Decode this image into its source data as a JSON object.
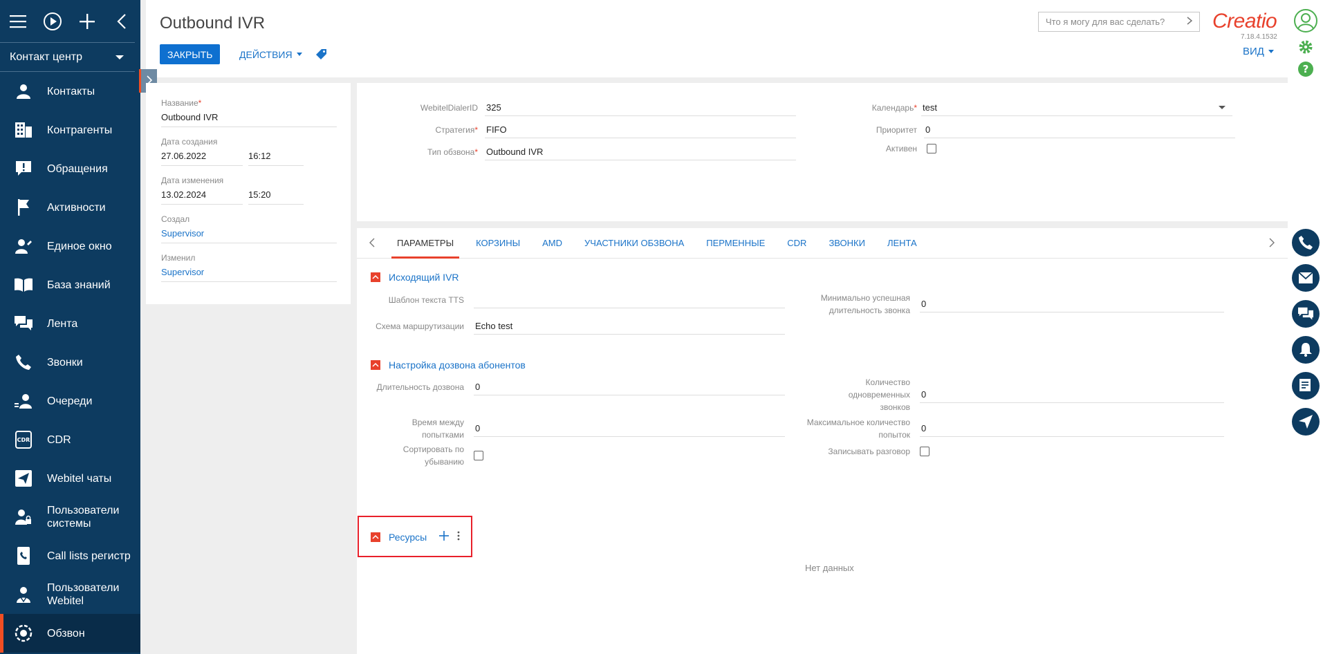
{
  "sidebar": {
    "section_label": "Контакт центр",
    "items": [
      {
        "label": "Контакты",
        "icon": "person-icon"
      },
      {
        "label": "Контрагенты",
        "icon": "building-icon"
      },
      {
        "label": "Обращения",
        "icon": "exclamation-icon"
      },
      {
        "label": "Активности",
        "icon": "flag-icon"
      },
      {
        "label": "Единое окно",
        "icon": "person-edit-icon"
      },
      {
        "label": "База знаний",
        "icon": "book-icon"
      },
      {
        "label": "Лента",
        "icon": "chat-icon"
      },
      {
        "label": "Звонки",
        "icon": "phone-icon"
      },
      {
        "label": "Очереди",
        "icon": "queue-icon"
      },
      {
        "label": "CDR",
        "icon": "cdr-icon"
      },
      {
        "label": "Webitel чаты",
        "icon": "send-icon"
      },
      {
        "label": "Пользователи системы",
        "icon": "user-lock-icon"
      },
      {
        "label": "Call lists регистр",
        "icon": "phone-book-icon"
      },
      {
        "label": "Пользователи Webitel",
        "icon": "users-icon"
      },
      {
        "label": "Обзвон",
        "icon": "dialer-icon"
      }
    ]
  },
  "header": {
    "title": "Outbound IVR",
    "close_label": "ЗАКРЫТЬ",
    "actions_label": "ДЕЙСТВИЯ",
    "search_placeholder": "Что я могу для вас сделать?",
    "logo": "Creatio",
    "version": "7.18.4.1532",
    "view_label": "ВИД"
  },
  "info": {
    "name_label": "Название",
    "name_value": "Outbound IVR",
    "created_label": "Дата создания",
    "created_date": "27.06.2022",
    "created_time": "16:12",
    "modified_label": "Дата изменения",
    "modified_date": "13.02.2024",
    "modified_time": "15:20",
    "created_by_label": "Создал",
    "created_by": "Supervisor",
    "modified_by_label": "Изменил",
    "modified_by": "Supervisor"
  },
  "fields": {
    "dialer_id_label": "WebitelDialerID",
    "dialer_id": "325",
    "strategy_label": "Стратегия",
    "strategy": "FIFO",
    "call_type_label": "Тип обзвона",
    "call_type": "Outbound IVR",
    "calendar_label": "Календарь",
    "calendar": "test",
    "priority_label": "Приоритет",
    "priority": "0",
    "active_label": "Активен"
  },
  "tabs": [
    "ПАРАМЕТРЫ",
    "КОРЗИНЫ",
    "AMD",
    "УЧАСТНИКИ ОБЗВОНА",
    "ПЕРМЕННЫЕ",
    "CDR",
    "ЗВОНКИ",
    "ЛЕНТА"
  ],
  "group_ivr": {
    "title": "Исходящий IVR",
    "tts_label": "Шаблон текста TTS",
    "tts_value": "",
    "min_duration_label": "Минимально успешная длительность звонка",
    "min_duration": "0",
    "routing_label": "Схема маршрутизации",
    "routing": "Echo test"
  },
  "group_dial": {
    "title": "Настройка дозвона абонентов",
    "dial_duration_label": "Длительность дозвона",
    "dial_duration": "0",
    "concurrent_label": "Количество одновременных звонков",
    "concurrent": "0",
    "interval_label": "Время между попытками",
    "interval": "0",
    "max_attempts_label": "Максимальное количество попыток",
    "max_attempts": "0",
    "sort_desc_label": "Сортировать по убыванию",
    "record_label": "Записывать разговор"
  },
  "resources": {
    "title": "Ресурсы",
    "empty": "Нет данных"
  },
  "colors": {
    "sidebar_bg": "#0d3b60",
    "accent": "#e8412c",
    "primary_button": "#0e70d0",
    "link": "#1a73c8"
  }
}
